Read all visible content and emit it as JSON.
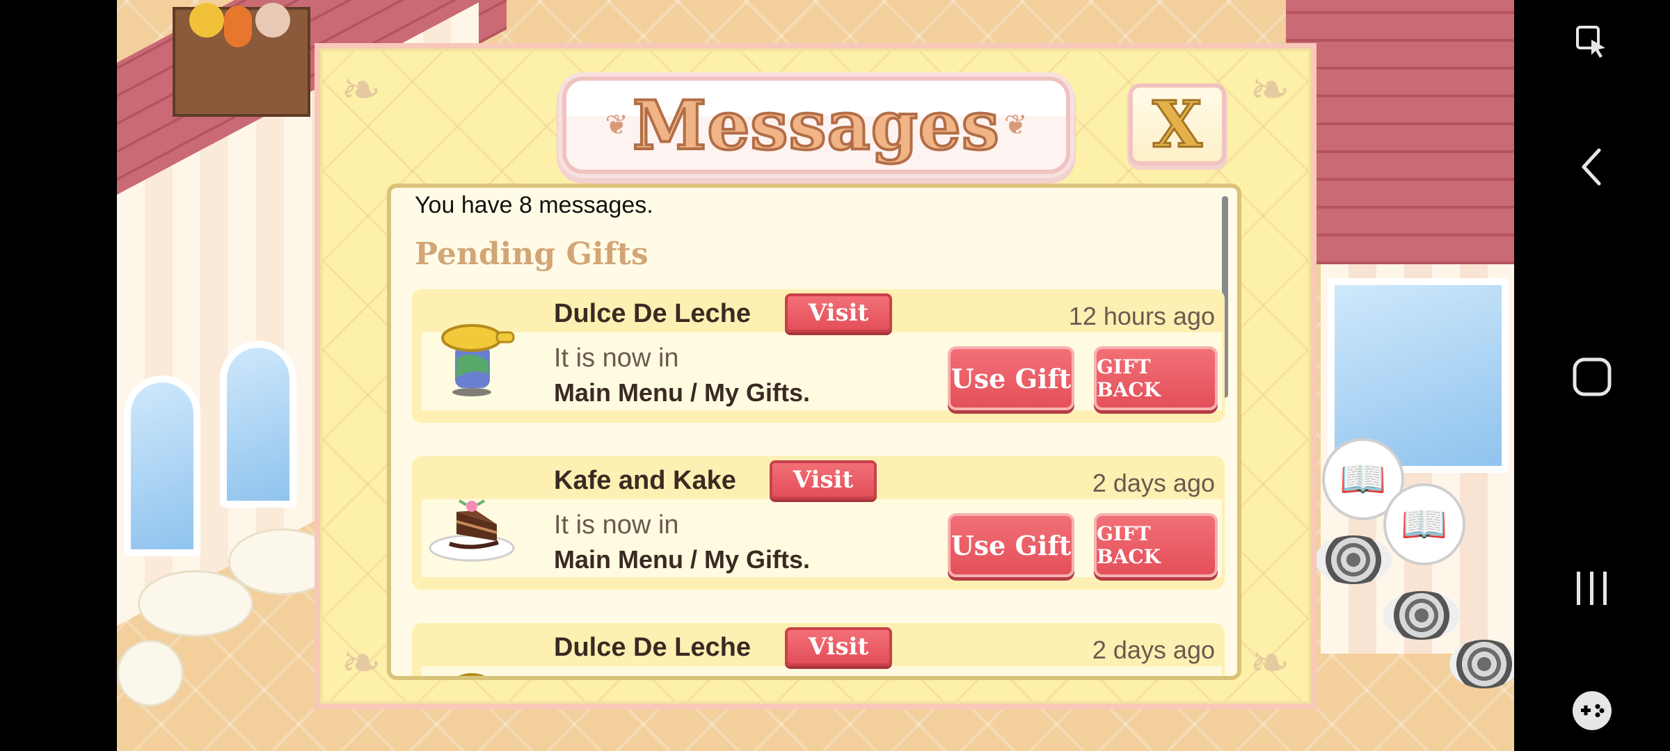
{
  "dialog": {
    "title": "Messages",
    "close_label": "X",
    "message_count_text": "You have 8 messages.",
    "section_heading": "Pending Gifts"
  },
  "messages": [
    {
      "sender": "Dulce De Leche",
      "visit_label": "Visit",
      "time": "12 hours ago",
      "body_line1": "It is now in",
      "body_line2": "Main Menu / My Gifts.",
      "use_gift_label": "Use Gift",
      "gift_back_label": "GIFT BACK",
      "icon": "teapot-icon"
    },
    {
      "sender": "Kafe and Kake",
      "visit_label": "Visit",
      "time": "2 days ago",
      "body_line1": "It is now in",
      "body_line2": "Main Menu / My Gifts.",
      "use_gift_label": "Use Gift",
      "gift_back_label": "GIFT BACK",
      "icon": "cake-slice-icon"
    },
    {
      "sender": "Dulce De Leche",
      "visit_label": "Visit",
      "time": "2 days ago",
      "icon": "gift-item-icon"
    }
  ],
  "nav": {
    "icons": [
      "keyboard-pointer-icon",
      "back-icon",
      "home-icon",
      "recents-icon",
      "game-tools-icon"
    ]
  },
  "colors": {
    "accent_red": "#e4505a",
    "panel_yellow": "#fdf0a8",
    "title_orange": "#f0b486"
  }
}
